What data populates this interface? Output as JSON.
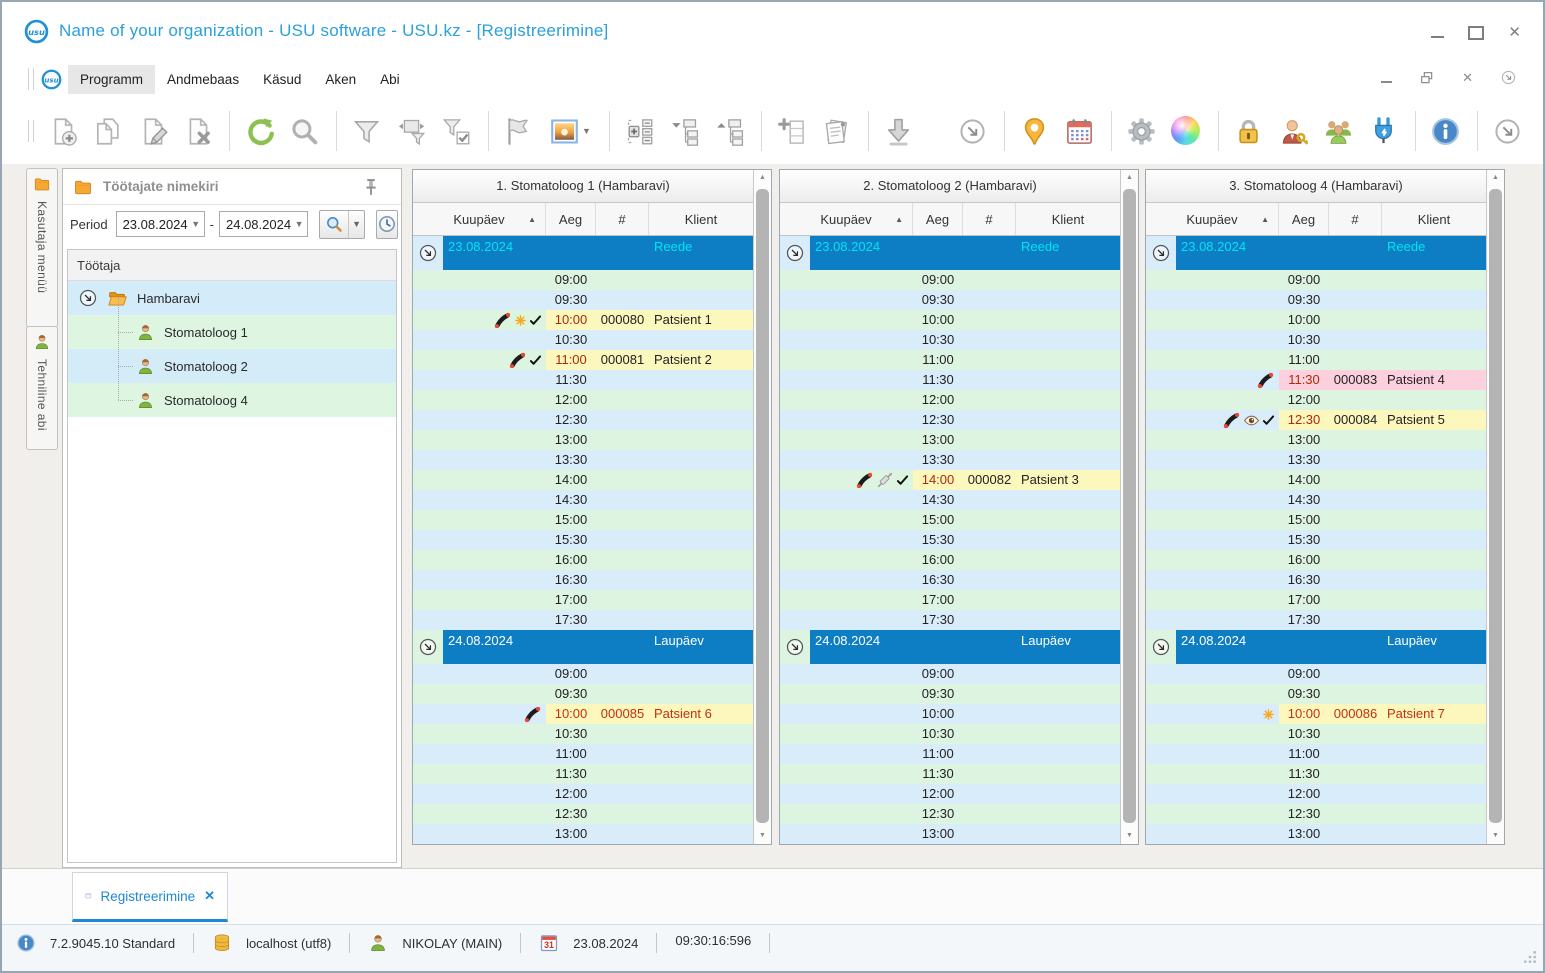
{
  "titlebar": {
    "title": "Name of your organization - USU software - USU.kz - [Registreerimine]"
  },
  "menubar": {
    "items": [
      "Programm",
      "Andmebaas",
      "Käsud",
      "Aken",
      "Abi"
    ],
    "active": "Programm"
  },
  "toolbar": {
    "left_groups": [
      [
        "doc-new",
        "doc-copy",
        "doc-edit",
        "doc-delete"
      ],
      [
        "refresh",
        "search"
      ],
      [
        "filter",
        "filter-columns",
        "filter-check"
      ],
      [
        "flag",
        "image"
      ],
      [
        "expand-nodes",
        "collapse-branch",
        "expand-branch"
      ],
      [
        "add-row",
        "documents"
      ],
      [
        "download"
      ]
    ],
    "right_groups": [
      [
        "overflow-chevron"
      ],
      [
        "map-pin",
        "calendar"
      ],
      [
        "gear",
        "color-wheel"
      ],
      [
        "lock",
        "user-key",
        "users-group",
        "plug"
      ],
      [
        "info"
      ],
      [
        "overflow-chevron"
      ]
    ]
  },
  "side_tabs": [
    {
      "label": "Kasutaja menüü",
      "icon": "folder"
    },
    {
      "label": "Tehniline abi",
      "icon": "person"
    }
  ],
  "employee_panel": {
    "title": "Töötajate nimekiri",
    "period_label": "Period",
    "date_from": "23.08.2024",
    "range_separator": "-",
    "date_to": "24.08.2024",
    "tree_header": "Töötaja",
    "tree": {
      "root": "Hambaravi",
      "children": [
        "Stomatoloog 1",
        "Stomatoloog 2",
        "Stomatoloog 4"
      ]
    }
  },
  "schedule": {
    "column_headers": [
      "Kuupäev",
      "Aeg",
      "#",
      "Klient"
    ],
    "columns": [
      "1. Stomatoloog 1 (Hambaravi)",
      "2. Stomatoloog 2 (Hambaravi)",
      "3. Stomatoloog 4 (Hambaravi)"
    ],
    "days": [
      {
        "date": "23.08.2024",
        "weekday": "Reede",
        "text_color": "#00e4f2",
        "stripe_start": "green",
        "times": [
          "09:00",
          "09:30",
          "10:00",
          "10:30",
          "11:00",
          "11:30",
          "12:00",
          "12:30",
          "13:00",
          "13:30",
          "14:00",
          "14:30",
          "15:00",
          "15:30",
          "16:00",
          "16:30",
          "17:00",
          "17:30"
        ]
      },
      {
        "date": "24.08.2024",
        "weekday": "Laupäev",
        "text_color": "#ffffff",
        "stripe_start": "blue",
        "times": [
          "09:00",
          "09:30",
          "10:00",
          "10:30",
          "11:00",
          "11:30",
          "12:00",
          "12:30",
          "13:00"
        ]
      }
    ],
    "appointments": [
      {
        "column": 0,
        "day": 0,
        "time": "10:00",
        "number": "000080",
        "client": "Patsient 1",
        "bg": "yellow",
        "icons": [
          "phone",
          "star",
          "check"
        ],
        "all_red": false
      },
      {
        "column": 0,
        "day": 0,
        "time": "11:00",
        "number": "000081",
        "client": "Patsient 2",
        "bg": "yellow",
        "icons": [
          "phone",
          "check"
        ],
        "all_red": false
      },
      {
        "column": 0,
        "day": 1,
        "time": "10:00",
        "number": "000085",
        "client": "Patsient 6",
        "bg": "yellow",
        "icons": [
          "phone"
        ],
        "all_red": true
      },
      {
        "column": 1,
        "day": 0,
        "time": "14:00",
        "number": "000082",
        "client": "Patsient 3",
        "bg": "yellow",
        "icons": [
          "phone",
          "syringe",
          "check"
        ],
        "all_red": false
      },
      {
        "column": 2,
        "day": 0,
        "time": "11:30",
        "number": "000083",
        "client": "Patsient 4",
        "bg": "pink",
        "icons": [
          "phone"
        ],
        "all_red": false
      },
      {
        "column": 2,
        "day": 0,
        "time": "12:30",
        "number": "000084",
        "client": "Patsient 5",
        "bg": "yellow",
        "icons": [
          "phone",
          "eye",
          "check"
        ],
        "all_red": false
      },
      {
        "column": 2,
        "day": 1,
        "time": "10:00",
        "number": "000086",
        "client": "Patsient 7",
        "bg": "yellow",
        "icons": [
          "star"
        ],
        "all_red": true
      }
    ]
  },
  "bottom_tab": {
    "label": "Registreerimine",
    "close": "✕"
  },
  "statusbar": {
    "version": "7.2.9045.10 Standard",
    "database": "localhost (utf8)",
    "user": "NIKOLAY (MAIN)",
    "date": "23.08.2024",
    "time": "09:30:16:596"
  },
  "colors": {
    "title_blue": "#2aa0dc",
    "tab_blue": "#1e88d2",
    "day_band_blue": "#0d7ec4",
    "day_text_friday": "#00e4f2",
    "day_text_saturday": "#ffffff",
    "stripe_green": "#ddf4e0",
    "stripe_blue": "#d9ecfa",
    "appt_yellow": "#fbf7bd",
    "appt_pink": "#fdd0dd",
    "time_red": "#b02808",
    "all_red": "#c5310f"
  }
}
